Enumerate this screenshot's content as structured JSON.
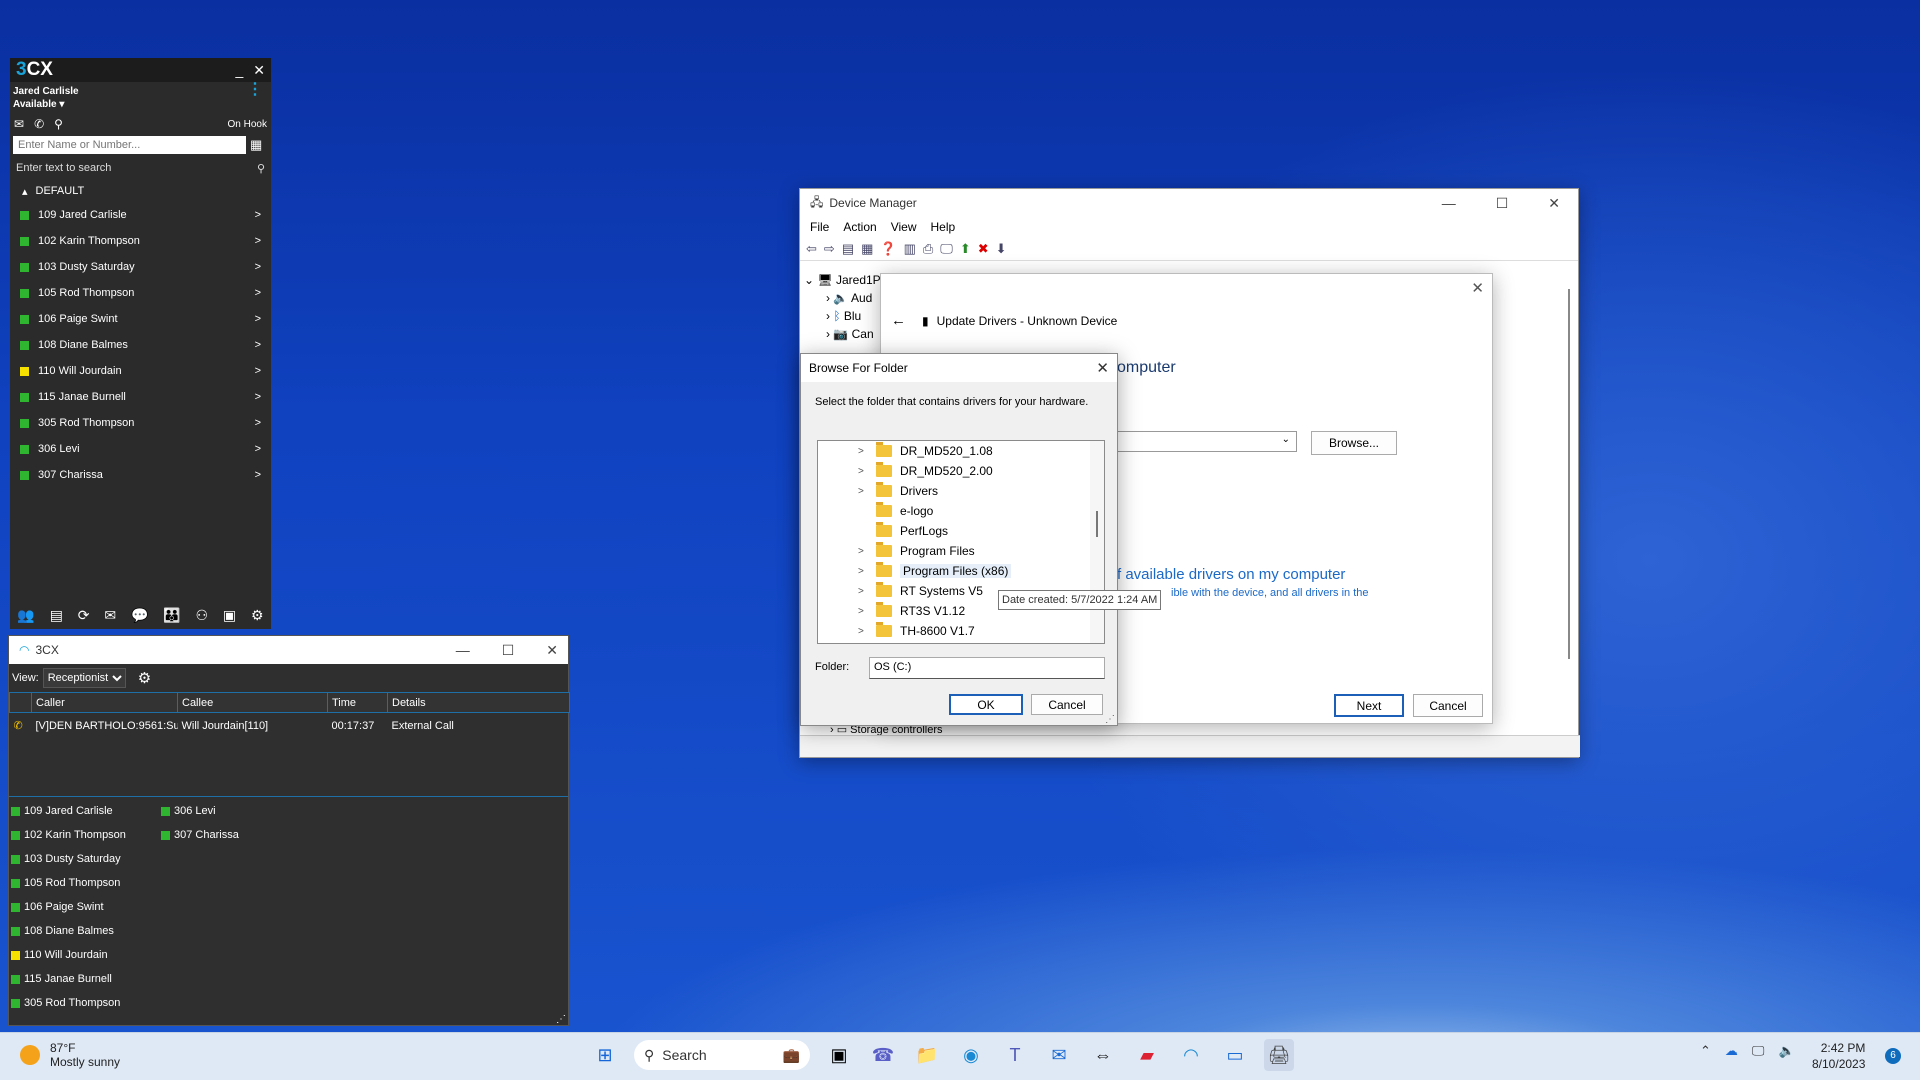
{
  "cx_mini": {
    "logo_prefix": "3",
    "logo_suffix": "CX",
    "user_name": "Jared Carlisle",
    "status": "Available ▾",
    "hook_status": "On Hook",
    "dial_placeholder": "Enter Name or Number...",
    "search_placeholder": "Enter text to search",
    "group_name": "DEFAULT",
    "contacts": [
      {
        "label": "109 Jared Carlisle",
        "status": "green"
      },
      {
        "label": "102 Karin Thompson",
        "status": "green"
      },
      {
        "label": "103 Dusty Saturday",
        "status": "green"
      },
      {
        "label": "105 Rod Thompson",
        "status": "green"
      },
      {
        "label": "106 Paige Swint",
        "status": "green"
      },
      {
        "label": "108 Diane Balmes",
        "status": "green"
      },
      {
        "label": "110 Will Jourdain",
        "status": "yellow"
      },
      {
        "label": "115 Janae Burnell",
        "status": "green"
      },
      {
        "label": "305 Rod Thompson",
        "status": "green"
      },
      {
        "label": "306 Levi",
        "status": "green"
      },
      {
        "label": "307 Charissa",
        "status": "green"
      }
    ]
  },
  "receptionist": {
    "title": "3CX",
    "view_label": "View:",
    "view_value": "Receptionist",
    "columns": [
      "Caller",
      "Callee",
      "Time",
      "Details"
    ],
    "calls": [
      {
        "caller": "[V]DEN BARTHOLO:9561:Su",
        "callee": "Will Jourdain[110]",
        "time": "00:17:37",
        "details": "External Call"
      }
    ],
    "extensions": [
      {
        "label": "109 Jared Carlisle",
        "status": "green"
      },
      {
        "label": "102 Karin Thompson",
        "status": "green"
      },
      {
        "label": "103 Dusty Saturday",
        "status": "green"
      },
      {
        "label": "105 Rod Thompson",
        "status": "green"
      },
      {
        "label": "106 Paige Swint",
        "status": "green"
      },
      {
        "label": "108 Diane Balmes",
        "status": "green"
      },
      {
        "label": "110 Will Jourdain",
        "status": "yellow"
      },
      {
        "label": "115 Janae Burnell",
        "status": "green"
      },
      {
        "label": "305 Rod Thompson",
        "status": "green"
      },
      {
        "label": "306 Levi",
        "status": "green"
      },
      {
        "label": "307 Charissa",
        "status": "green"
      }
    ]
  },
  "device_manager": {
    "title": "Device Manager",
    "menu": [
      "File",
      "Action",
      "View",
      "Help"
    ],
    "tree": [
      "Jared1P",
      "Aud",
      "Blu",
      "Can",
      "Storage controllers"
    ]
  },
  "update_drivers": {
    "header": "Update Drivers - Unknown Device",
    "heading_fragment": "omputer",
    "browse_button": "Browse...",
    "link_text": "f available drivers on my computer",
    "link_sub": "ible with the device, and all drivers in the",
    "next_button": "Next",
    "cancel_button": "Cancel"
  },
  "browse_folder": {
    "title": "Browse For Folder",
    "description": "Select the folder that contains drivers for your hardware.",
    "folders": [
      {
        "name": "DR_MD520_1.08",
        "expandable": true
      },
      {
        "name": "DR_MD520_2.00",
        "expandable": true
      },
      {
        "name": "Drivers",
        "expandable": true
      },
      {
        "name": "e-logo",
        "expandable": false
      },
      {
        "name": "PerfLogs",
        "expandable": false
      },
      {
        "name": "Program Files",
        "expandable": true
      },
      {
        "name": "Program Files (x86)",
        "expandable": true
      },
      {
        "name": "RT Systems V5",
        "expandable": true
      },
      {
        "name": "RT3S V1.12",
        "expandable": true
      },
      {
        "name": "TH-8600 V1.7",
        "expandable": true
      }
    ],
    "folder_label": "Folder:",
    "folder_value": "OS (C:)",
    "ok_button": "OK",
    "cancel_button": "Cancel",
    "tooltip": "Date created: 5/7/2022 1:24 AM"
  },
  "taskbar": {
    "temperature": "87°F",
    "weather": "Mostly sunny",
    "search_placeholder": "Search",
    "time": "2:42 PM",
    "date": "8/10/2023",
    "notifications": "6"
  },
  "colors": {
    "green": "#2fb52f",
    "yellow": "#f5e000",
    "accent": "#19a3d8"
  }
}
